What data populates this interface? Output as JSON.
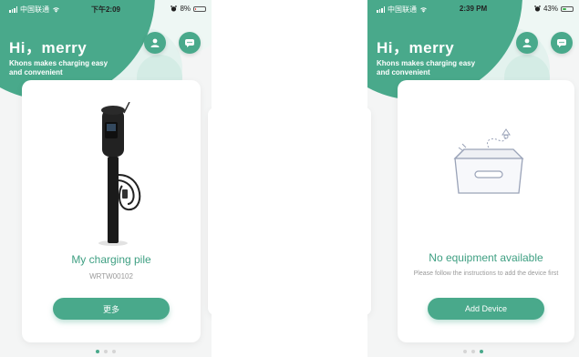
{
  "left_screen": {
    "status": {
      "carrier": "中国联通",
      "time": "下午2:09",
      "battery": "8%",
      "battery_level": 0.08
    },
    "greeting": {
      "title": "Hi，merry",
      "subtitle": "Khons makes charging easy and convenient"
    },
    "card": {
      "title": "My charging pile",
      "serial": "WRTW00102",
      "button_label": "更多"
    },
    "page_index": 0,
    "page_count": 3
  },
  "right_screen": {
    "status": {
      "carrier": "中国联通",
      "time": "2:39 PM",
      "battery": "43%",
      "battery_level": 0.43
    },
    "greeting": {
      "title": "Hi，merry",
      "subtitle": "Khons makes charging easy and convenient"
    },
    "card": {
      "title": "No equipment available",
      "hint": "Please follow the instructions to add the device first",
      "button_label": "Add Device"
    },
    "page_index": 2,
    "page_count": 3
  },
  "colors": {
    "brand": "#49a98b",
    "title_green": "#3e9f82",
    "muted": "#9a9a9a"
  },
  "icons": [
    "signal-icon",
    "wifi-icon",
    "alarm-icon",
    "battery-icon",
    "user-icon",
    "message-icon",
    "charging-pile-icon",
    "empty-box-icon"
  ]
}
